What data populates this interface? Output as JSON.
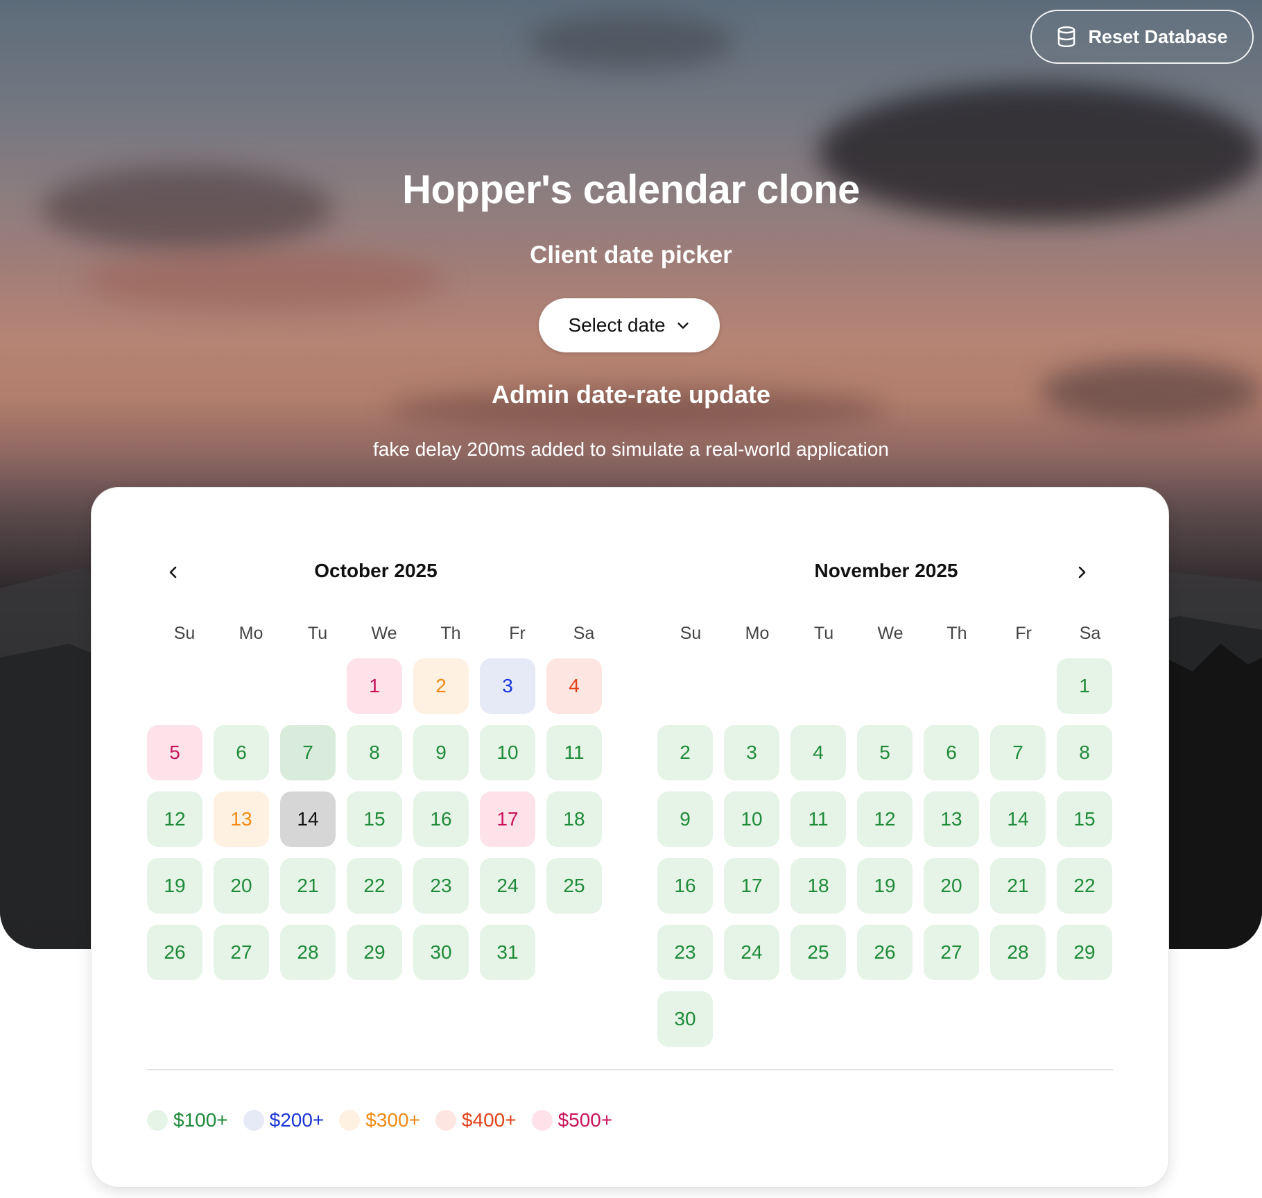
{
  "header": {
    "reset_button": "Reset Database",
    "title": "Hopper's calendar clone",
    "client_picker_title": "Client date picker",
    "select_button": "Select date",
    "admin_title": "Admin date-rate update",
    "delay_note": "fake delay 200ms added to simulate a real-world application"
  },
  "calendar": {
    "weekdays": [
      "Su",
      "Mo",
      "Tu",
      "We",
      "Th",
      "Fr",
      "Sa"
    ],
    "months": [
      {
        "title": "October 2025",
        "nav": "previous",
        "leading_blanks": 3,
        "days": [
          {
            "n": "1",
            "tier": "pink"
          },
          {
            "n": "2",
            "tier": "orange"
          },
          {
            "n": "3",
            "tier": "blue"
          },
          {
            "n": "4",
            "tier": "red"
          },
          {
            "n": "5",
            "tier": "pink"
          },
          {
            "n": "6",
            "tier": "green"
          },
          {
            "n": "7",
            "tier": "selected"
          },
          {
            "n": "8",
            "tier": "green"
          },
          {
            "n": "9",
            "tier": "green"
          },
          {
            "n": "10",
            "tier": "green"
          },
          {
            "n": "11",
            "tier": "green"
          },
          {
            "n": "12",
            "tier": "green"
          },
          {
            "n": "13",
            "tier": "orange"
          },
          {
            "n": "14",
            "tier": "today"
          },
          {
            "n": "15",
            "tier": "green"
          },
          {
            "n": "16",
            "tier": "green"
          },
          {
            "n": "17",
            "tier": "pink"
          },
          {
            "n": "18",
            "tier": "green"
          },
          {
            "n": "19",
            "tier": "green"
          },
          {
            "n": "20",
            "tier": "green"
          },
          {
            "n": "21",
            "tier": "green"
          },
          {
            "n": "22",
            "tier": "green"
          },
          {
            "n": "23",
            "tier": "green"
          },
          {
            "n": "24",
            "tier": "green"
          },
          {
            "n": "25",
            "tier": "green"
          },
          {
            "n": "26",
            "tier": "green"
          },
          {
            "n": "27",
            "tier": "green"
          },
          {
            "n": "28",
            "tier": "green"
          },
          {
            "n": "29",
            "tier": "green"
          },
          {
            "n": "30",
            "tier": "green"
          },
          {
            "n": "31",
            "tier": "green"
          }
        ]
      },
      {
        "title": "November 2025",
        "nav": "next",
        "leading_blanks": 6,
        "days": [
          {
            "n": "1",
            "tier": "green"
          },
          {
            "n": "2",
            "tier": "green"
          },
          {
            "n": "3",
            "tier": "green"
          },
          {
            "n": "4",
            "tier": "green"
          },
          {
            "n": "5",
            "tier": "green"
          },
          {
            "n": "6",
            "tier": "green"
          },
          {
            "n": "7",
            "tier": "green"
          },
          {
            "n": "8",
            "tier": "green"
          },
          {
            "n": "9",
            "tier": "green"
          },
          {
            "n": "10",
            "tier": "green"
          },
          {
            "n": "11",
            "tier": "green"
          },
          {
            "n": "12",
            "tier": "green"
          },
          {
            "n": "13",
            "tier": "green"
          },
          {
            "n": "14",
            "tier": "green"
          },
          {
            "n": "15",
            "tier": "green"
          },
          {
            "n": "16",
            "tier": "green"
          },
          {
            "n": "17",
            "tier": "green"
          },
          {
            "n": "18",
            "tier": "green"
          },
          {
            "n": "19",
            "tier": "green"
          },
          {
            "n": "20",
            "tier": "green"
          },
          {
            "n": "21",
            "tier": "green"
          },
          {
            "n": "22",
            "tier": "green"
          },
          {
            "n": "23",
            "tier": "green"
          },
          {
            "n": "24",
            "tier": "green"
          },
          {
            "n": "25",
            "tier": "green"
          },
          {
            "n": "26",
            "tier": "green"
          },
          {
            "n": "27",
            "tier": "green"
          },
          {
            "n": "28",
            "tier": "green"
          },
          {
            "n": "29",
            "tier": "green"
          },
          {
            "n": "30",
            "tier": "green"
          }
        ]
      }
    ]
  },
  "legend": [
    {
      "label": "$100+",
      "color": "#1f8a3a",
      "bg": "#e5f4e6"
    },
    {
      "label": "$200+",
      "color": "#1a36d6",
      "bg": "#e6e9f6"
    },
    {
      "label": "$300+",
      "color": "#f08a12",
      "bg": "#fff1e2"
    },
    {
      "label": "$400+",
      "color": "#e2421a",
      "bg": "#fde6e2"
    },
    {
      "label": "$500+",
      "color": "#c8135a",
      "bg": "#fde2ea"
    }
  ],
  "icons": {
    "reset": "database-icon",
    "select": "chevron-down-icon",
    "prev": "chevron-left-icon",
    "next": "chevron-right-icon"
  }
}
